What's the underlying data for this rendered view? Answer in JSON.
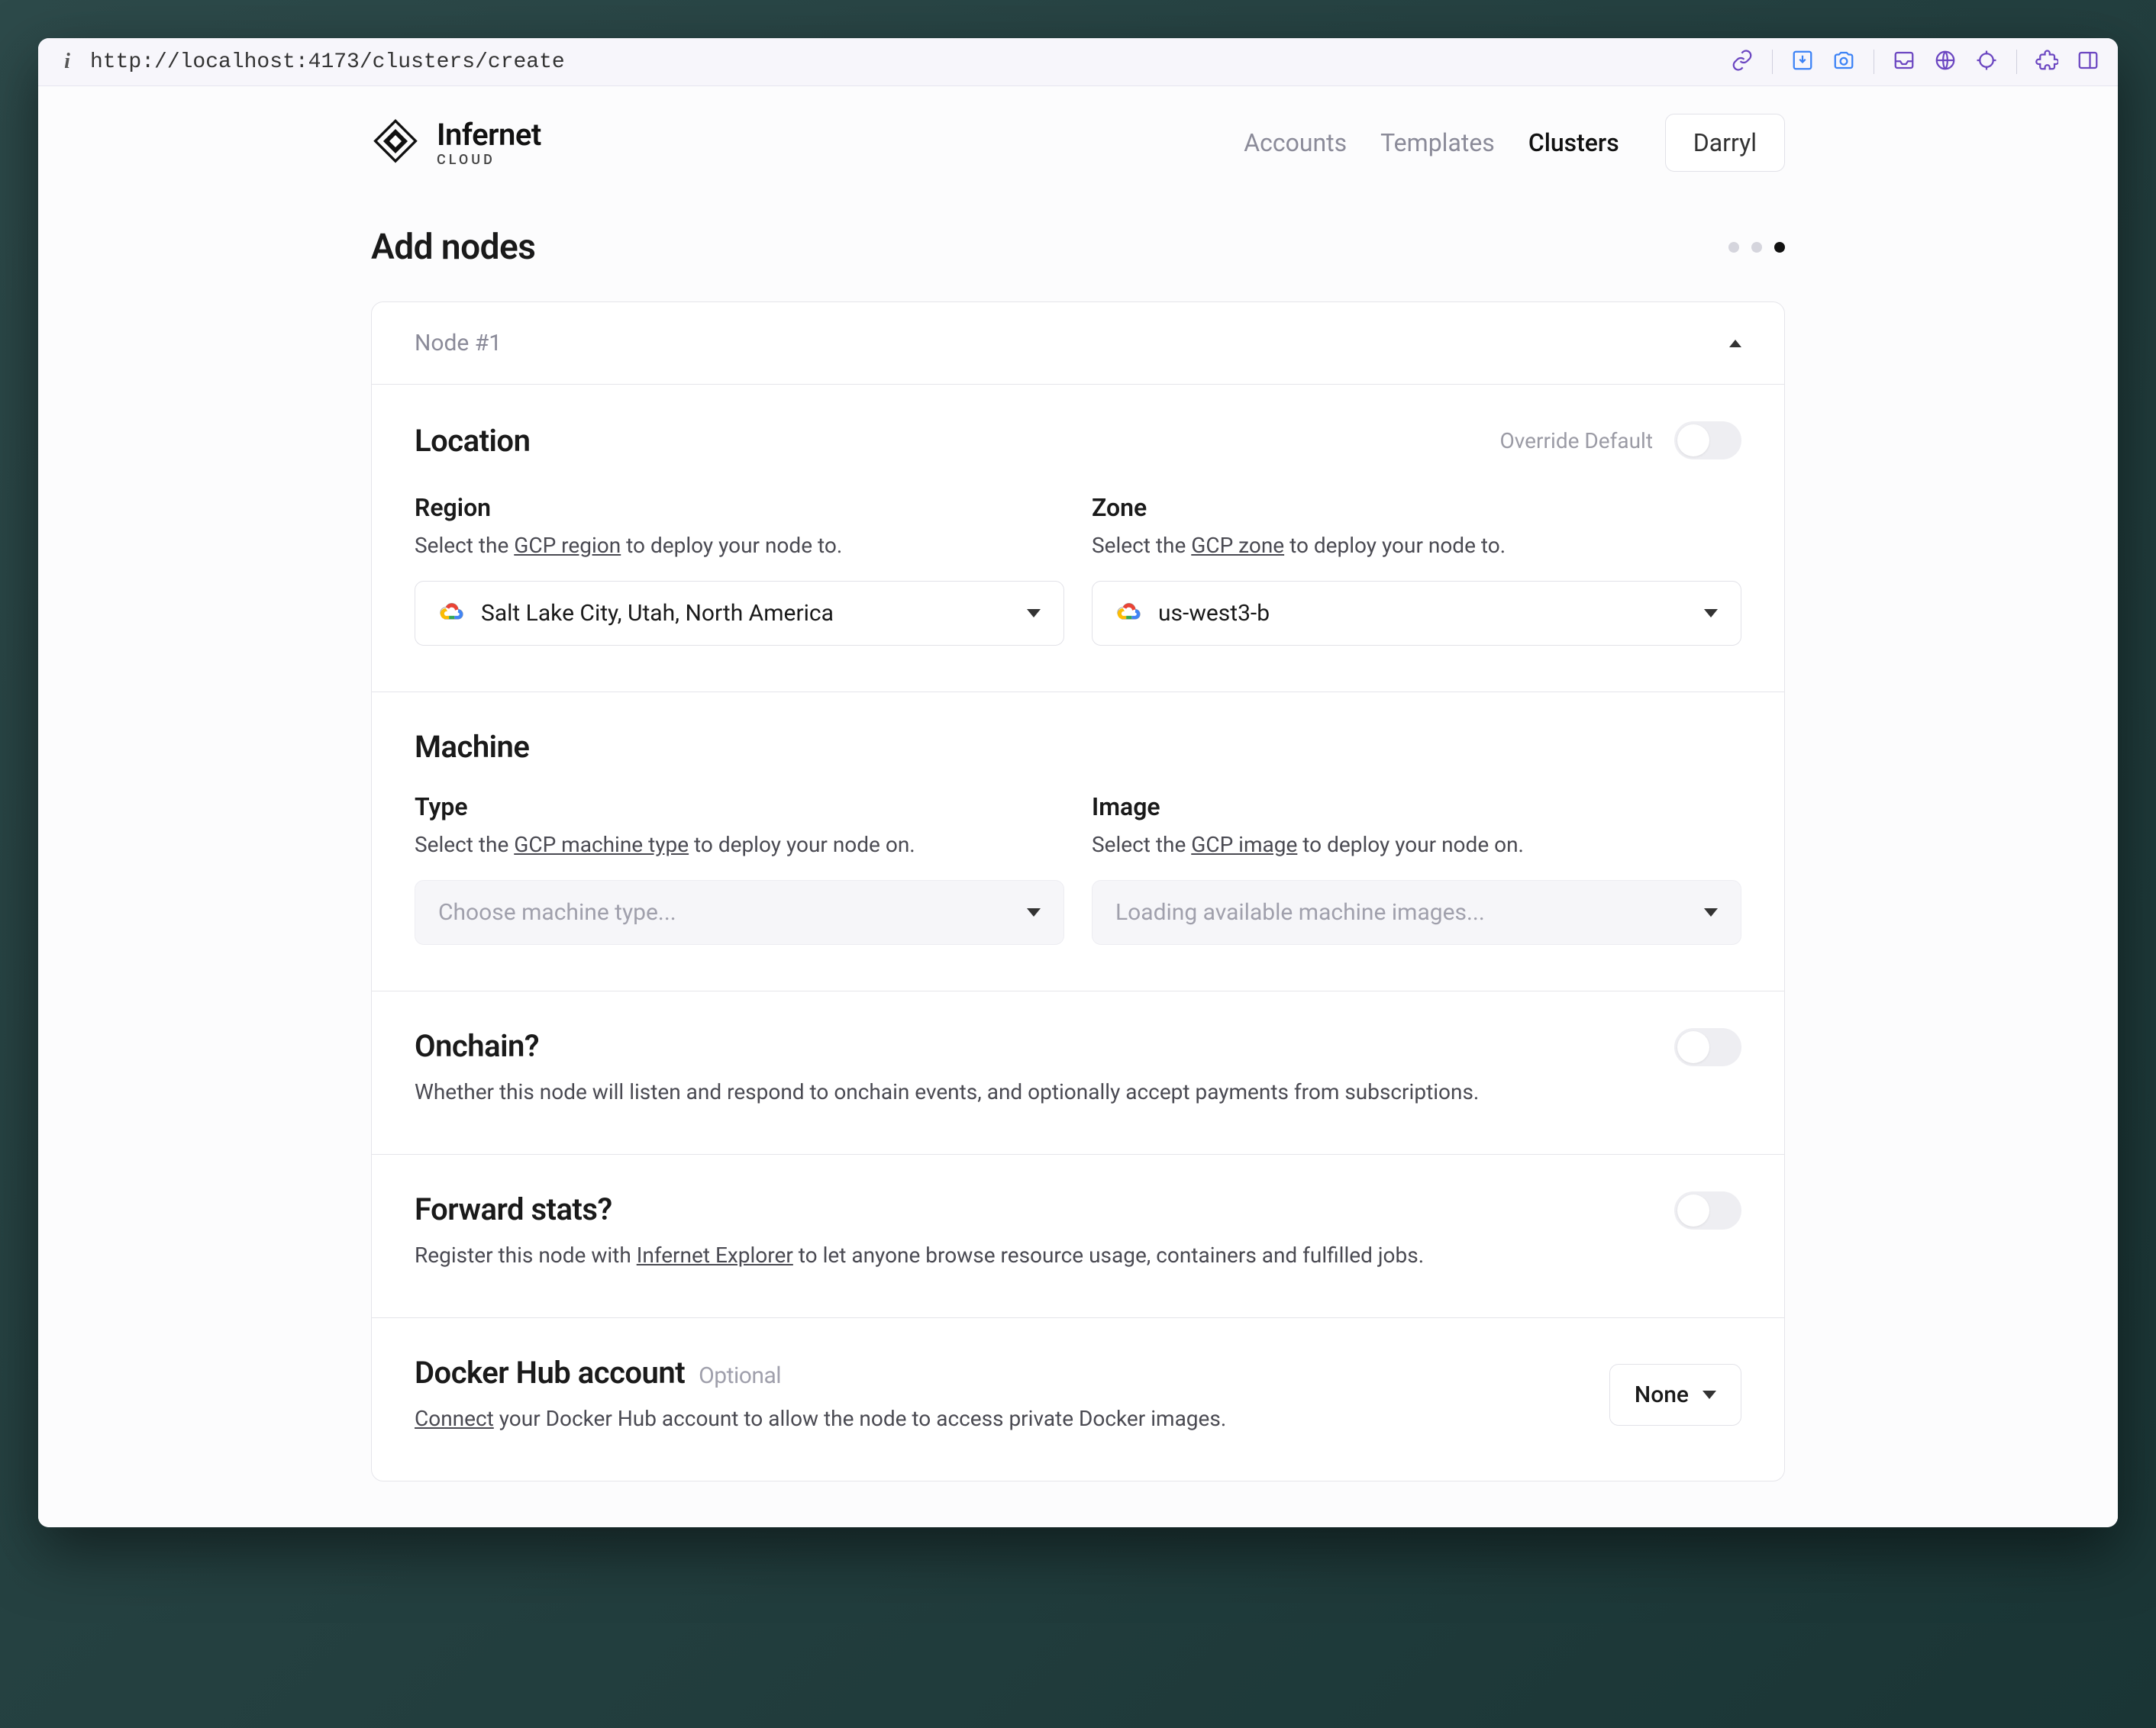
{
  "browser": {
    "url": "http://localhost:4173/clusters/create"
  },
  "header": {
    "brand_title": "Infernet",
    "brand_sub": "CLOUD",
    "nav": {
      "accounts": "Accounts",
      "templates": "Templates",
      "clusters": "Clusters"
    },
    "user": "Darryl"
  },
  "page": {
    "heading": "Add nodes",
    "node_card": {
      "title": "Node #1"
    },
    "location": {
      "title": "Location",
      "override_label": "Override Default",
      "region": {
        "label": "Region",
        "help_pre": "Select the ",
        "help_link": "GCP region",
        "help_post": " to deploy your node to.",
        "value": "Salt Lake City, Utah, North America"
      },
      "zone": {
        "label": "Zone",
        "help_pre": "Select the ",
        "help_link": "GCP zone",
        "help_post": " to deploy your node to.",
        "value": "us-west3-b"
      }
    },
    "machine": {
      "title": "Machine",
      "type": {
        "label": "Type",
        "help_pre": "Select the ",
        "help_link": "GCP machine type",
        "help_post": " to deploy your node on.",
        "placeholder": "Choose machine type..."
      },
      "image": {
        "label": "Image",
        "help_pre": "Select the ",
        "help_link": "GCP image",
        "help_post": " to deploy your node on.",
        "placeholder": "Loading available machine images..."
      }
    },
    "onchain": {
      "title": "Onchain?",
      "desc": "Whether this node will listen and respond to onchain events, and optionally accept payments from subscriptions."
    },
    "forward_stats": {
      "title": "Forward stats?",
      "desc_pre": "Register this node with ",
      "desc_link": "Infernet Explorer",
      "desc_post": " to let anyone browse resource usage, containers and fulfilled jobs."
    },
    "docker": {
      "title": "Docker Hub account",
      "optional": "Optional",
      "desc_link": "Connect",
      "desc_post": " your Docker Hub account to allow the node to access private Docker images.",
      "value": "None"
    }
  }
}
